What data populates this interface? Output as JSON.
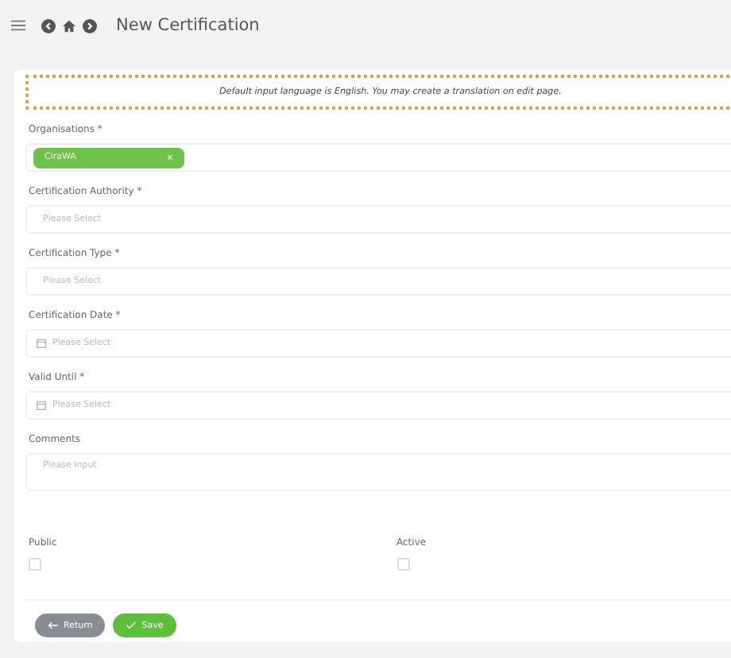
{
  "header": {
    "title": "New Certification"
  },
  "notice": "Default input language is English. You may create a translation on edit page.",
  "fields": [
    {
      "kind": "tags",
      "label": "Organisations *",
      "tags": [
        "CiraWA"
      ]
    },
    {
      "kind": "select",
      "label": "Certification Authority *",
      "placeholder": "Please Select"
    },
    {
      "kind": "select",
      "label": "Certification Type *",
      "placeholder": "Please Select"
    },
    {
      "kind": "date",
      "label": "Certification Date *",
      "placeholder": "Please Select"
    },
    {
      "kind": "date",
      "label": "Valid Until *",
      "placeholder": "Please Select"
    },
    {
      "kind": "textarea",
      "label": "Comments",
      "placeholder": "Please Input"
    }
  ],
  "checkboxes": [
    {
      "label": "Public",
      "checked": false
    },
    {
      "label": "Active",
      "checked": false
    }
  ],
  "buttons": [
    {
      "kind": "return",
      "label": "Return"
    },
    {
      "kind": "save",
      "label": "Save"
    }
  ]
}
